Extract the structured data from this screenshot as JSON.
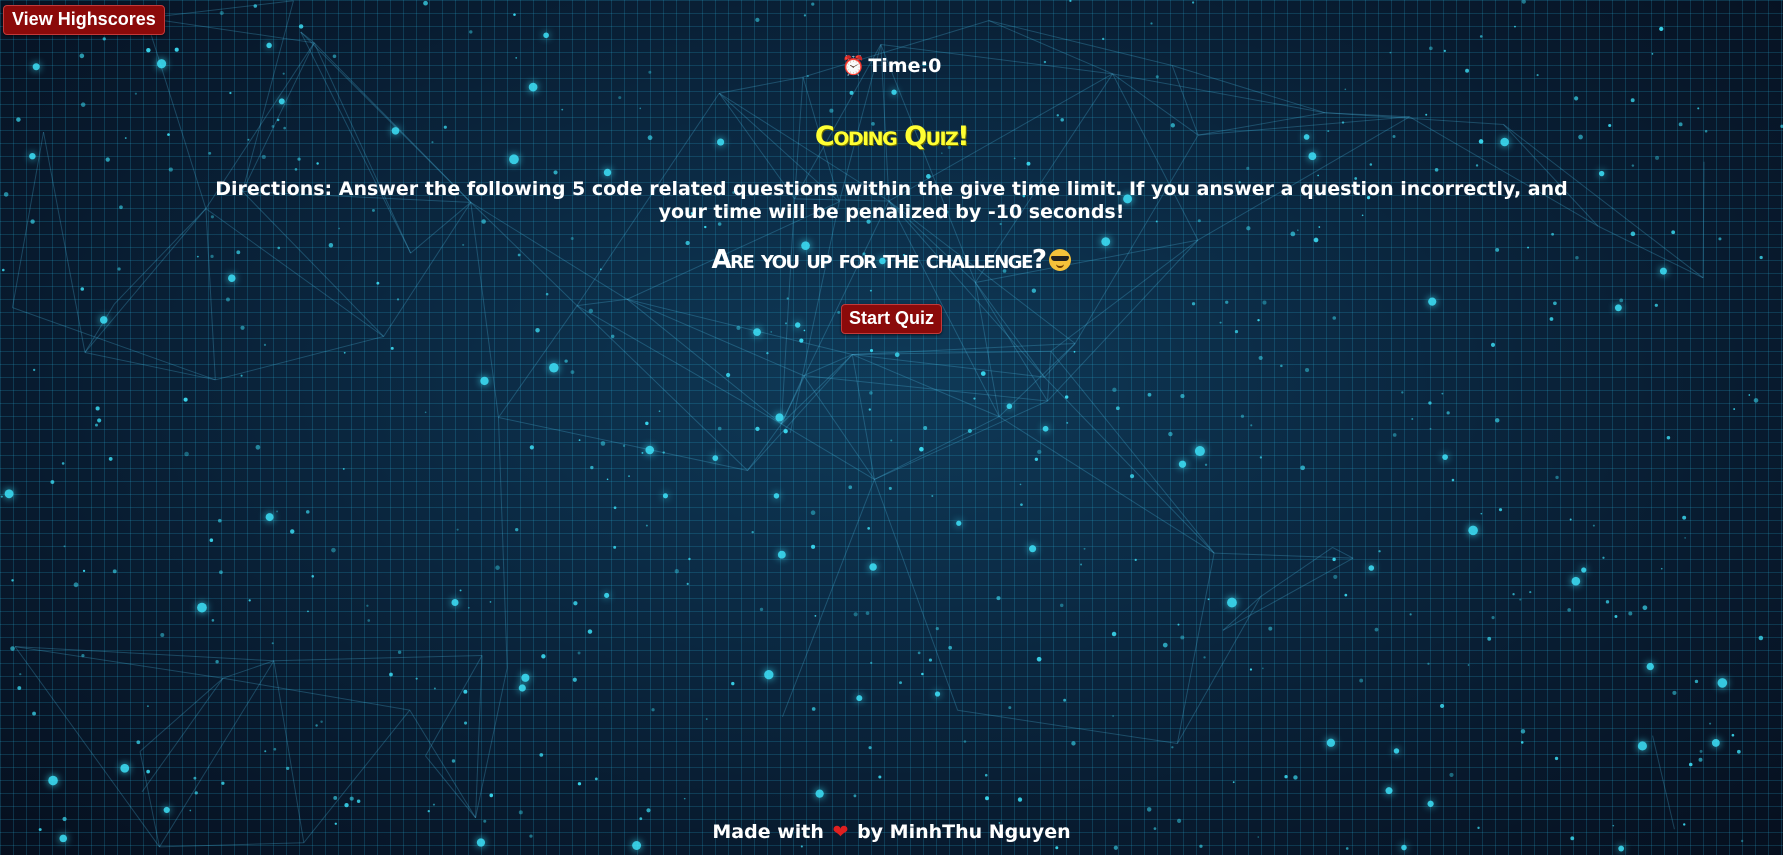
{
  "header": {
    "highscores_label": "View Highscores"
  },
  "timer": {
    "label": "Time:",
    "value": "0",
    "icon": "alarm-clock-icon"
  },
  "main": {
    "title": "Coding Quiz!",
    "directions": "Directions: Answer the following 5 code related questions within the give time limit. If you answer a question incorrectly, and your time will be penalized by -10 seconds!",
    "challenge_text": "Are you up for the challenge?",
    "challenge_icon": "sunglasses-face-icon",
    "start_label": "Start Quiz"
  },
  "footer": {
    "made_with": "Made with",
    "heart_icon": "heart-icon",
    "by_text": "by MinhThu Nguyen"
  },
  "colors": {
    "button_bg": "#8b0a0a",
    "title_color": "#ffff33",
    "text_color": "#ffffff",
    "background": "#0b2a44",
    "particle_color": "#3fe8ff"
  }
}
